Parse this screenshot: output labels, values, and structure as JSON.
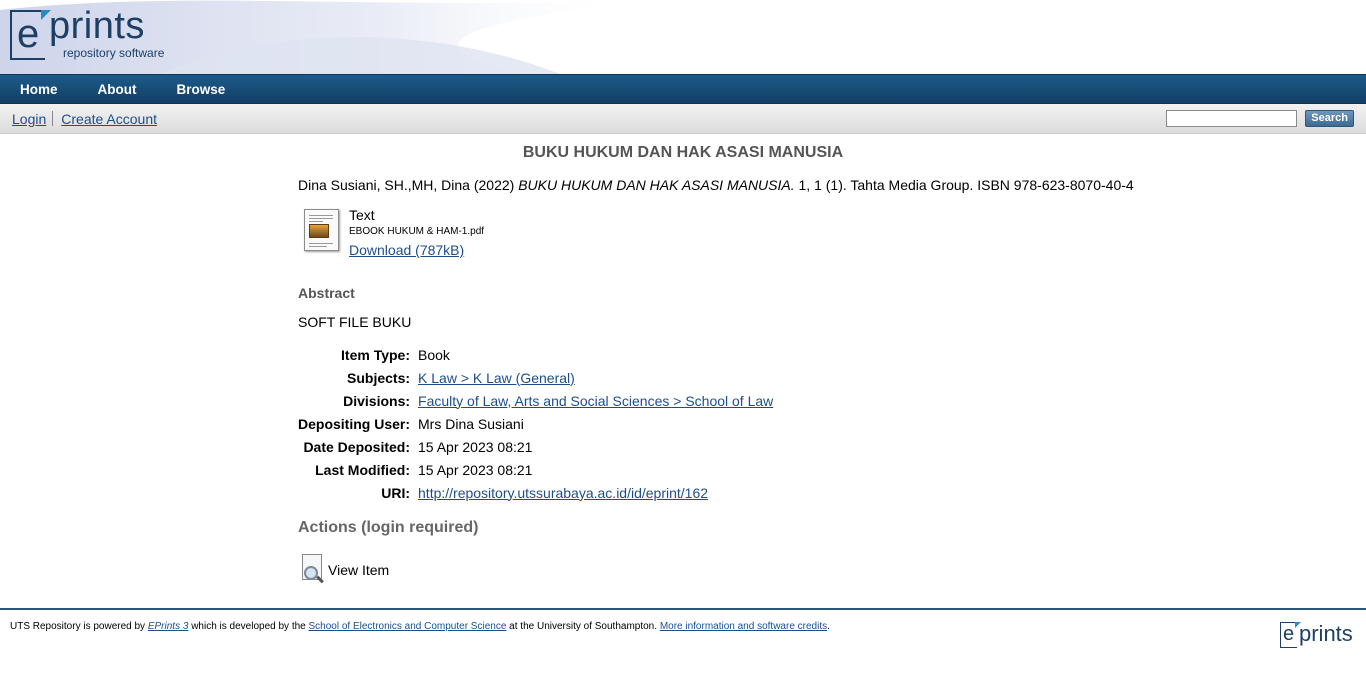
{
  "logo": {
    "e": "e",
    "prints": "prints",
    "tagline": "repository software",
    "footer_e": "e",
    "footer_prints": "prints"
  },
  "nav": {
    "home": "Home",
    "about": "About",
    "browse": "Browse"
  },
  "loginbar": {
    "login": "Login",
    "create_account": "Create Account",
    "search_value": "",
    "search_button": "Search"
  },
  "item": {
    "title": "BUKU HUKUM DAN HAK ASASI MANUSIA",
    "citation_prefix": "Dina Susiani, SH.,MH, Dina (2022)",
    "citation_title": "BUKU HUKUM DAN HAK ASASI MANUSIA.",
    "citation_suffix": "1, 1 (1). Tahta Media Group. ISBN 978-623-8070-40-4",
    "document": {
      "format": "Text",
      "filename": "EBOOK HUKUM & HAM-1.pdf",
      "download": "Download (787kB)"
    },
    "abstract_heading": "Abstract",
    "abstract_text": "SOFT FILE BUKU",
    "details": [
      {
        "key": "Item Type:",
        "value": "Book",
        "link": false
      },
      {
        "key": "Subjects:",
        "value": "K Law > K Law (General)",
        "link": true
      },
      {
        "key": "Divisions:",
        "value": "Faculty of Law, Arts and Social Sciences > School of Law",
        "link": true
      },
      {
        "key": "Depositing User:",
        "value": "Mrs Dina Susiani",
        "link": false
      },
      {
        "key": "Date Deposited:",
        "value": "15 Apr 2023 08:21",
        "link": false
      },
      {
        "key": "Last Modified:",
        "value": "15 Apr 2023 08:21",
        "link": false
      },
      {
        "key": "URI:",
        "value": "http://repository.utssurabaya.ac.id/id/eprint/162",
        "link": true
      }
    ],
    "actions_heading": "Actions (login required)",
    "view_item": "View Item"
  },
  "footer": {
    "t1": "UTS Repository is powered by ",
    "eprints_link": "EPrints 3",
    "t2": " which is developed by the ",
    "school_link": "School of Electronics and Computer Science",
    "t3": " at the University of Southampton. ",
    "credits_link": "More information and software credits",
    "t4": "."
  },
  "colors": {
    "nav_bg": "#1d5a89",
    "link": "#1d4e89",
    "heading_gray": "#555555"
  }
}
